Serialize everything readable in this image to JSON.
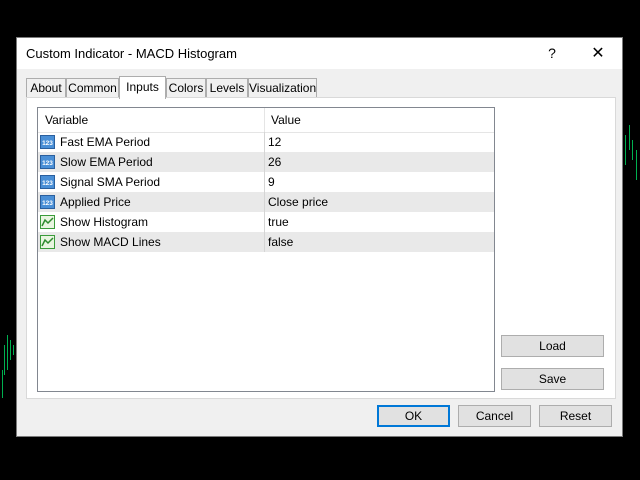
{
  "window": {
    "title": "Custom Indicator - MACD Histogram",
    "help_label": "?",
    "close_label": "✕"
  },
  "tabs": [
    {
      "label": "About"
    },
    {
      "label": "Common"
    },
    {
      "label": "Inputs",
      "active": true
    },
    {
      "label": "Colors"
    },
    {
      "label": "Levels"
    },
    {
      "label": "Visualization"
    }
  ],
  "grid": {
    "headers": {
      "variable": "Variable",
      "value": "Value"
    },
    "rows": [
      {
        "icon": "numeric-123-icon",
        "name": "Fast EMA Period",
        "value": "12"
      },
      {
        "icon": "numeric-123-icon",
        "name": "Slow EMA Period",
        "value": "26"
      },
      {
        "icon": "numeric-123-icon",
        "name": "Signal SMA Period",
        "value": "9"
      },
      {
        "icon": "numeric-123-icon",
        "name": "Applied Price",
        "value": "Close price"
      },
      {
        "icon": "boolean-chart-icon",
        "name": "Show Histogram",
        "value": "true"
      },
      {
        "icon": "boolean-chart-icon",
        "name": "Show MACD Lines",
        "value": "false"
      }
    ]
  },
  "side_buttons": {
    "load": "Load",
    "save": "Save"
  },
  "footer_buttons": {
    "ok": "OK",
    "cancel": "Cancel",
    "reset": "Reset"
  },
  "colors": {
    "background": "#000000",
    "chart_ticks": "#00b050",
    "ok_border": "#0078d7"
  }
}
